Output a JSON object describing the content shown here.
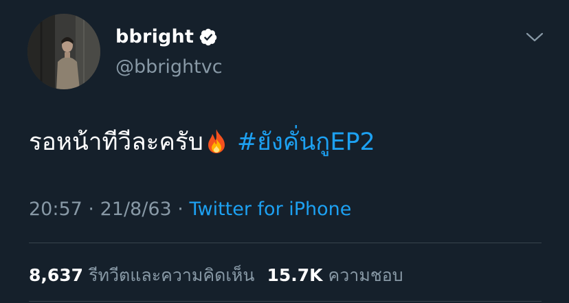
{
  "tweet": {
    "author": {
      "display_name": "bbright",
      "handle": "@bbrightvc",
      "verified": true
    },
    "text": "รอหน้าทีวีละครับ",
    "emoji": "fire-emoji",
    "hashtag": "#ยังคั่นกูEP2",
    "time": "20:57",
    "separator": "·",
    "date": "21/8/63",
    "source": "Twitter for iPhone",
    "stats": {
      "retweets_count": "8,637",
      "retweets_label": "รีทวีตและความคิดเห็น",
      "likes_count": "15.7K",
      "likes_label": "ความชอบ"
    }
  },
  "colors": {
    "background": "#15202b",
    "text_primary": "#ffffff",
    "text_secondary": "#8899a6",
    "accent": "#1da1f2",
    "divider": "#38444d"
  },
  "icons": [
    "verified-badge-icon",
    "chevron-down-icon",
    "fire-emoji"
  ]
}
